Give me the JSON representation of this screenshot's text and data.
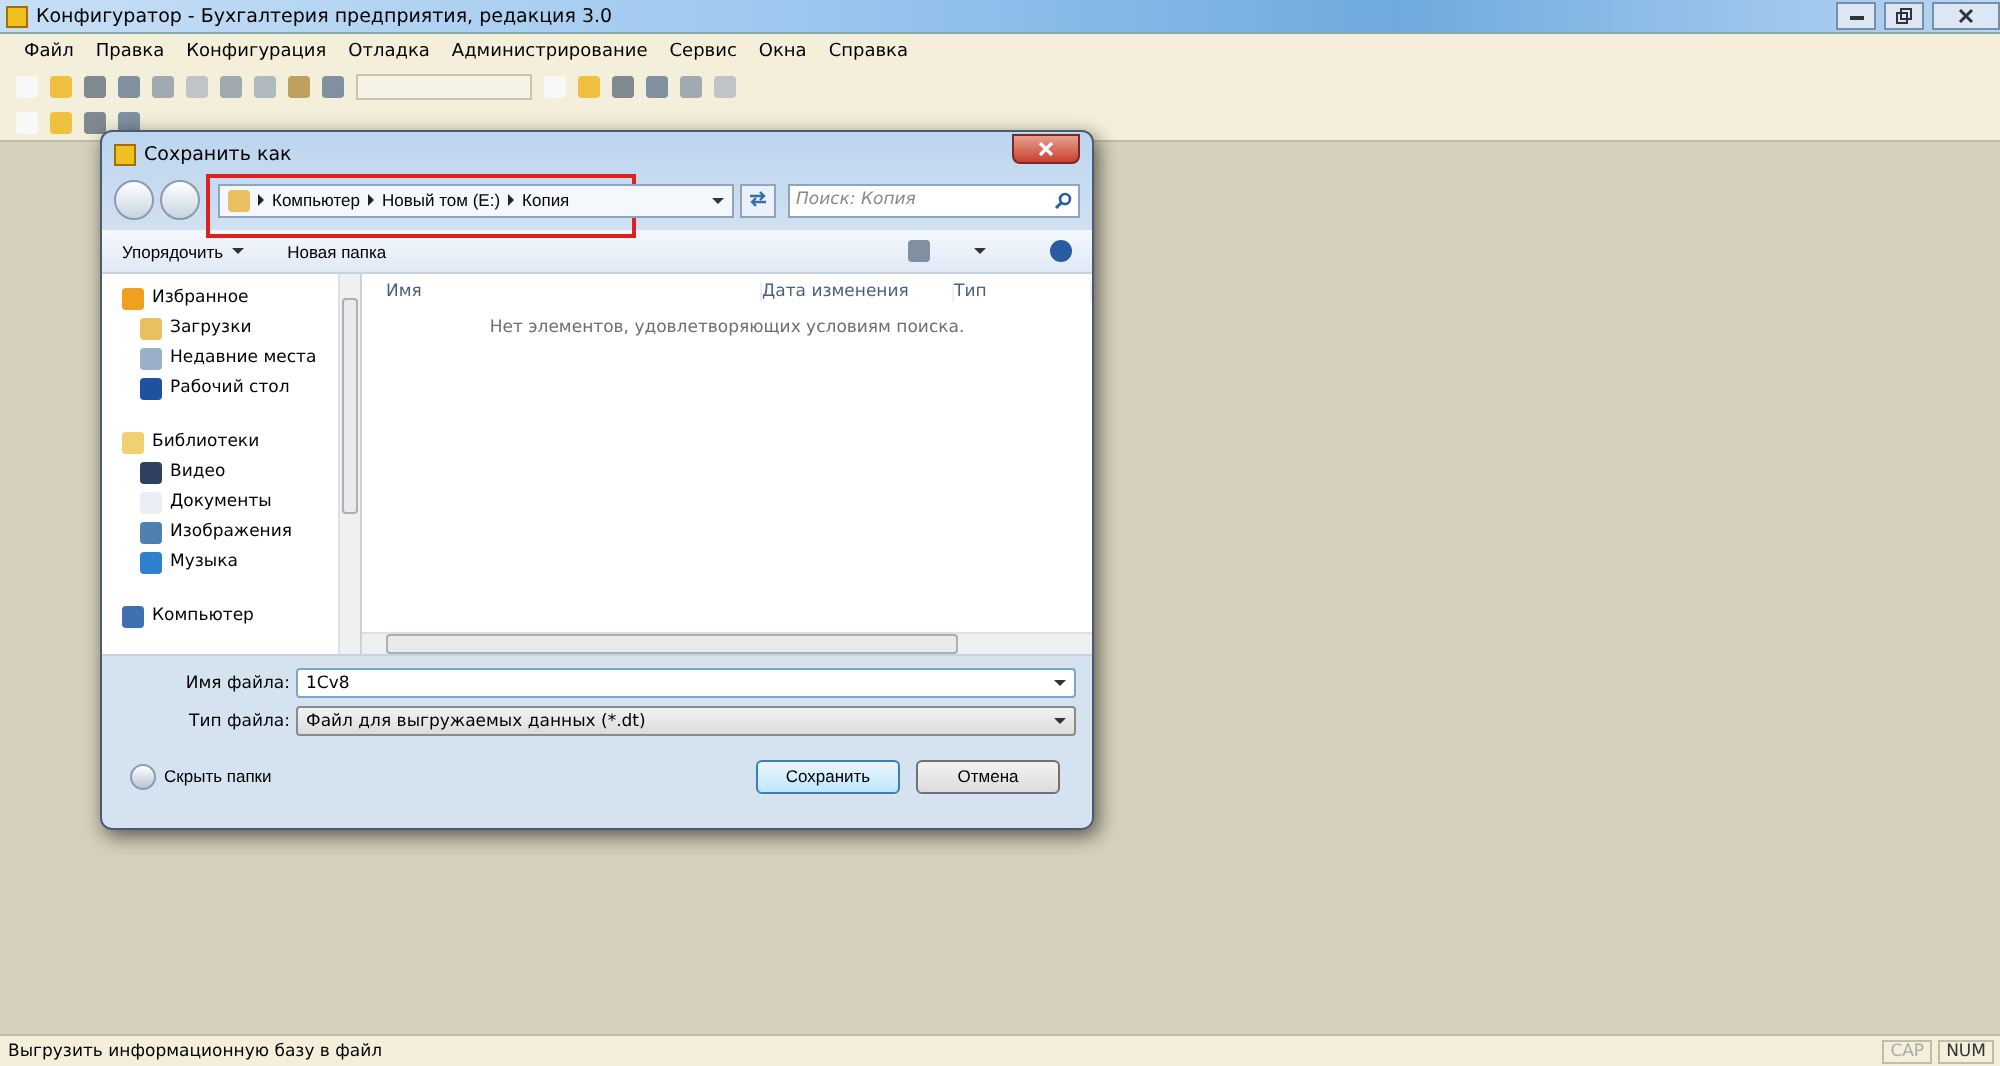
{
  "window": {
    "title": "Конфигуратор - Бухгалтерия предприятия, редакция 3.0"
  },
  "menu": [
    "Файл",
    "Правка",
    "Конфигурация",
    "Отладка",
    "Администрирование",
    "Сервис",
    "Окна",
    "Справка"
  ],
  "dialog": {
    "title": "Сохранить как",
    "address": [
      "Компьютер",
      "Новый том (E:)",
      "Копия"
    ],
    "search": {
      "placeholder": "Поиск: Копия"
    },
    "commands": [
      {
        "label": "Упорядочить",
        "caret": true
      },
      {
        "label": "Новая папка",
        "caret": false
      }
    ],
    "nav": [
      {
        "label": "Избранное",
        "children": [
          {
            "label": "Загрузки"
          },
          {
            "label": "Недавние места"
          },
          {
            "label": "Рабочий стол"
          }
        ]
      },
      {
        "label": "Библиотеки",
        "children": [
          {
            "label": "Видео"
          },
          {
            "label": "Документы"
          },
          {
            "label": "Изображения"
          },
          {
            "label": "Музыка"
          }
        ]
      },
      {
        "label": "Компьютер"
      }
    ],
    "columns": [
      "Имя",
      "Дата изменения",
      "Тип"
    ],
    "empty_message": "Нет элементов, удовлетворяющих условиям поиска.",
    "fields": [
      {
        "label": "Имя файла:",
        "value": "1Cv8",
        "kind": "input"
      },
      {
        "label": "Тип файла:",
        "value": "Файл для выгружаемых данных (*.dt)",
        "kind": "select"
      }
    ],
    "hide_folders": "Скрыть папки",
    "buttons": [
      {
        "label": "Сохранить",
        "default": true
      },
      {
        "label": "Отмена",
        "default": false
      }
    ]
  },
  "status_bar": {
    "text": "Выгрузить информационную базу в файл",
    "indicators": [
      {
        "label": "CAP",
        "on": false
      },
      {
        "label": "NUM",
        "on": true
      }
    ]
  }
}
